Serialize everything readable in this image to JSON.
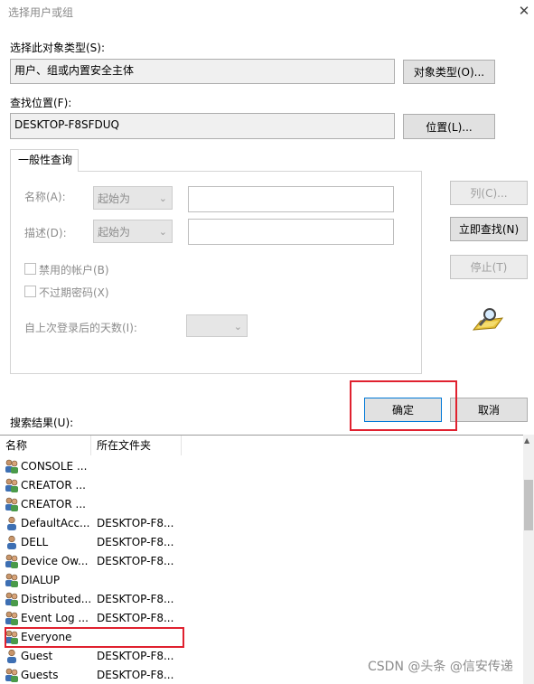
{
  "window": {
    "title": "选择用户或组"
  },
  "object_type": {
    "label": "选择此对象类型(S):",
    "value": "用户、组或内置安全主体",
    "button": "对象类型(O)..."
  },
  "location": {
    "label": "查找位置(F):",
    "value": "DESKTOP-F8SFDUQ",
    "button": "位置(L)..."
  },
  "query": {
    "tab": "一般性查询",
    "name_label": "名称(A):",
    "desc_label": "描述(D):",
    "name_mode": "起始为",
    "desc_mode": "起始为",
    "disabled_accounts": "禁用的帐户(B)",
    "no_expire_password": "不过期密码(X)",
    "days_since_login": "自上次登录后的天数(I):"
  },
  "side_buttons": {
    "columns": "列(C)...",
    "find_now": "立即查找(N)",
    "stop": "停止(T)"
  },
  "dialog_buttons": {
    "ok": "确定",
    "cancel": "取消"
  },
  "results": {
    "label": "搜索结果(U):",
    "columns": [
      "名称",
      "所在文件夹"
    ],
    "rows": [
      {
        "name": "CONSOLE ...",
        "folder": "",
        "icon": "group-icon"
      },
      {
        "name": "CREATOR ...",
        "folder": "",
        "icon": "group-icon"
      },
      {
        "name": "CREATOR ...",
        "folder": "",
        "icon": "group-icon"
      },
      {
        "name": "DefaultAcc...",
        "folder": "DESKTOP-F8...",
        "icon": "user-icon"
      },
      {
        "name": "DELL",
        "folder": "DESKTOP-F8...",
        "icon": "user-icon"
      },
      {
        "name": "Device Ow...",
        "folder": "DESKTOP-F8...",
        "icon": "group-icon"
      },
      {
        "name": "DIALUP",
        "folder": "",
        "icon": "group-icon"
      },
      {
        "name": "Distributed...",
        "folder": "DESKTOP-F8...",
        "icon": "group-icon"
      },
      {
        "name": "Event Log ...",
        "folder": "DESKTOP-F8...",
        "icon": "group-icon"
      },
      {
        "name": "Everyone",
        "folder": "",
        "icon": "group-icon"
      },
      {
        "name": "Guest",
        "folder": "DESKTOP-F8...",
        "icon": "user-icon"
      },
      {
        "name": "Guests",
        "folder": "DESKTOP-F8...",
        "icon": "group-icon"
      }
    ]
  },
  "watermark": "CSDN @头条 @信安传递",
  "colors": {
    "highlight_red": "#e0212f",
    "button_face": "#e1e1e1",
    "readonly_bg": "#f0f0f0"
  }
}
